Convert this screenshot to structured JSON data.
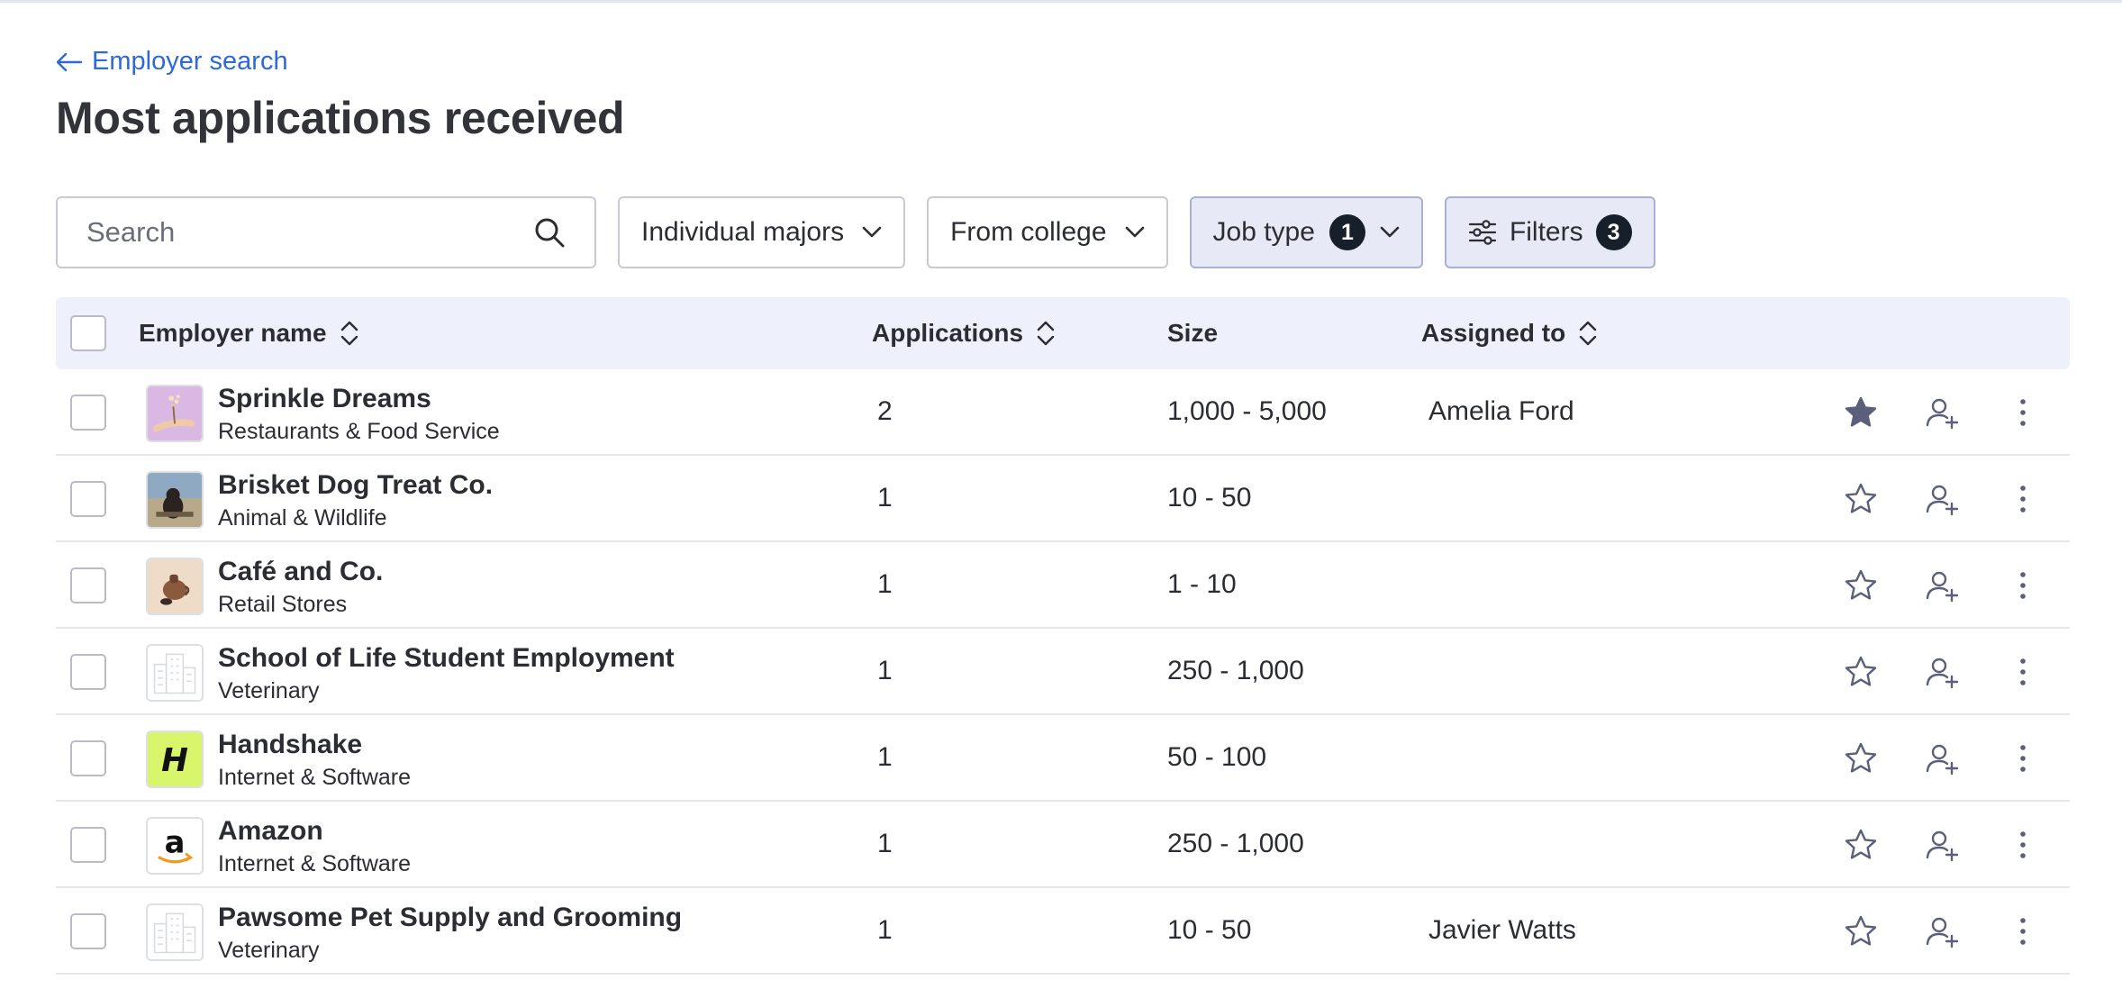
{
  "nav": {
    "back_label": "Employer search"
  },
  "page": {
    "title": "Most applications received"
  },
  "toolbar": {
    "search_placeholder": "Search",
    "majors_label": "Individual majors",
    "college_label": "From college",
    "job_type_label": "Job type",
    "job_type_count": "1",
    "filters_label": "Filters",
    "filters_count": "3"
  },
  "table": {
    "columns": [
      "Employer name",
      "Applications",
      "Size",
      "Assigned to"
    ],
    "rows": [
      {
        "name": "Sprinkle Dreams",
        "industry": "Restaurants & Food Service",
        "applications": "2",
        "size": "1,000 - 5,000",
        "assigned": "Amelia Ford",
        "favorited": true,
        "logo": "sprinkle-logo"
      },
      {
        "name": "Brisket Dog Treat Co.",
        "industry": "Animal & Wildlife",
        "applications": "1",
        "size": "10 - 50",
        "assigned": "",
        "favorited": false,
        "logo": "dog-photo-logo"
      },
      {
        "name": "Café and Co.",
        "industry": "Retail Stores",
        "applications": "1",
        "size": "1 - 10",
        "assigned": "",
        "favorited": false,
        "logo": "coffee-logo"
      },
      {
        "name": "School of Life Student Employment",
        "industry": "Veterinary",
        "applications": "1",
        "size": "250 - 1,000",
        "assigned": "",
        "favorited": false,
        "logo": "building-placeholder-logo"
      },
      {
        "name": "Handshake",
        "industry": "Internet & Software",
        "applications": "1",
        "size": "50 - 100",
        "assigned": "",
        "favorited": false,
        "logo": "handshake-logo"
      },
      {
        "name": "Amazon",
        "industry": "Internet & Software",
        "applications": "1",
        "size": "250 - 1,000",
        "assigned": "",
        "favorited": false,
        "logo": "amazon-logo"
      },
      {
        "name": "Pawsome Pet Supply and Grooming",
        "industry": "Veterinary",
        "applications": "1",
        "size": "10 - 50",
        "assigned": "Javier Watts",
        "favorited": false,
        "logo": "building-placeholder-logo"
      }
    ]
  },
  "colors": {
    "link": "#2d6ad6",
    "header_bg": "#eef1fb",
    "active_filter_bg": "#e7e9f7",
    "icon": "#5b5f7a",
    "badge": "#17202a"
  },
  "handshake_logo_text": "H",
  "amazon_logo_text": "a"
}
